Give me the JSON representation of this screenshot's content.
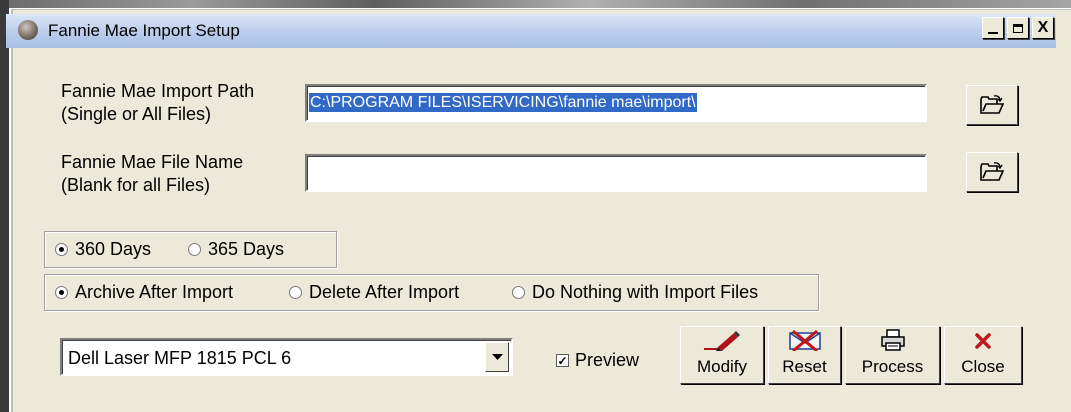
{
  "window": {
    "title": "Fannie Mae Import Setup"
  },
  "window_controls": {
    "minimize": "_",
    "maximize": "□",
    "close": "X"
  },
  "import_path": {
    "label": "Fannie Mae Import Path\n(Single or All Files)",
    "value": "C:\\PROGRAM FILES\\ISERVICING\\fannie mae\\import\\"
  },
  "file_name": {
    "label": "Fannie Mae File Name\n(Blank for all Files)",
    "value": ""
  },
  "days": {
    "options": [
      {
        "label": "360 Days",
        "selected": true
      },
      {
        "label": "365 Days",
        "selected": false
      }
    ]
  },
  "archive": {
    "options": [
      {
        "label": "Archive After Import",
        "selected": true
      },
      {
        "label": "Delete After Import",
        "selected": false
      },
      {
        "label": "Do Nothing with Import Files",
        "selected": false
      }
    ]
  },
  "printer": {
    "selected": "Dell Laser MFP 1815 PCL 6"
  },
  "preview": {
    "label": "Preview",
    "checked": true,
    "mark": "✓"
  },
  "toolbar": {
    "modify_label": "Modify",
    "reset_label": "Reset",
    "process_label": "Process",
    "close_label": "Close"
  },
  "icons": {
    "app": "app-globe-icon",
    "folder": "open-folder-icon",
    "modify": "pen-icon",
    "reset": "reset-envelope-icon",
    "process": "printer-icon",
    "close": "x-close-icon"
  },
  "colors": {
    "selection": "#3169c6",
    "titlebar": "#b8cbea",
    "close_red": "#c0171c"
  }
}
